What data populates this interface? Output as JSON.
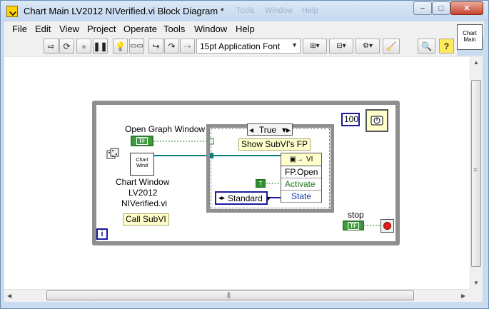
{
  "window": {
    "title": "Chart Main LV2012 NIVerified.vi Block Diagram *",
    "ghost_menus": [
      "Tools",
      "Window",
      "Help"
    ],
    "controls": {
      "minimize": "−",
      "maximize": "□",
      "close": "✕"
    }
  },
  "menubar": [
    "File",
    "Edit",
    "View",
    "Project",
    "Operate",
    "Tools",
    "Window",
    "Help"
  ],
  "toolbar": {
    "font": "15pt Application Font",
    "buttons": [
      "run-arrow-icon",
      "run-continuously-icon",
      "abort-icon",
      "pause-icon",
      "highlight-execution-icon",
      "retain-wire-values-icon",
      "step-into-icon",
      "step-over-icon",
      "step-out-icon",
      "align-icon",
      "distribute-icon",
      "reorder-icon",
      "cleanup-icon",
      "search-icon",
      "context-help-icon"
    ]
  },
  "vi_icon": {
    "line1": "Chart",
    "line2": "Main"
  },
  "diagram": {
    "open_graph_label": "Open Graph Window",
    "bool_text": "TF",
    "subvi_line1": "Chart",
    "subvi_line2": "Wind",
    "subvi_name_1": "Chart Window",
    "subvi_name_2": "LV2012",
    "subvi_name_3": "NIVerified.vi",
    "call_subvi_comment": "Call SubVI",
    "case_value": "True",
    "show_fp_comment": "Show SubVI's FP",
    "prop_head": "VI",
    "prop_row1": "FP.Open",
    "prop_row2": "Activate",
    "prop_row3": "State",
    "true_const": "T",
    "enum_value": "Standard",
    "wait_ms": "100",
    "stop_label": "stop",
    "iteration_terminal": "i"
  },
  "colors": {
    "loop_border": "#8f8f8f",
    "bool_green": "#3f9b3f",
    "numeric_blue": "#1a1aa0",
    "wire_teal": "#007c7c",
    "comment_yellow": "#ffffcc"
  }
}
